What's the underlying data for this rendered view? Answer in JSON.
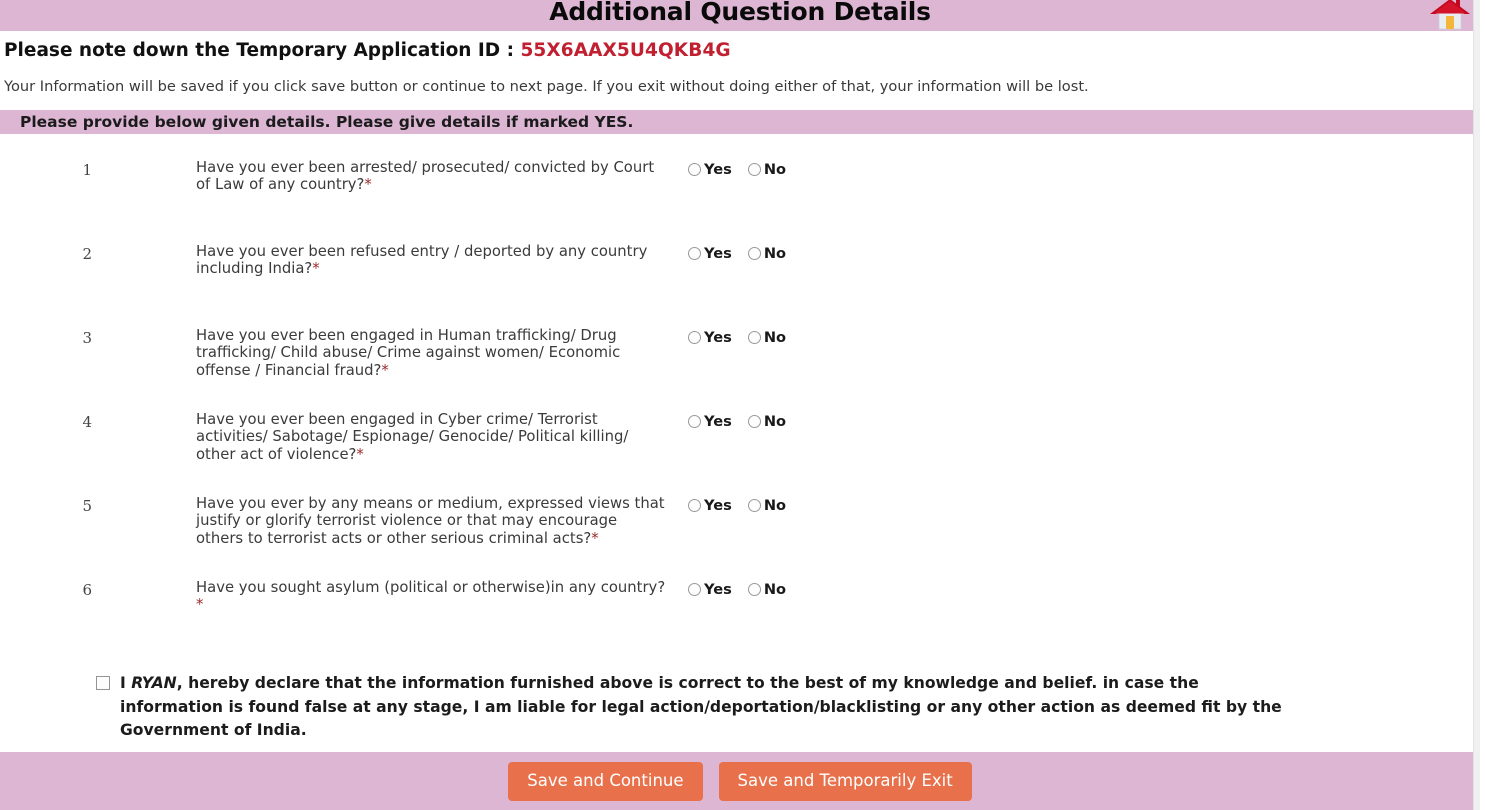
{
  "header": {
    "title": "Additional Question Details",
    "home_icon": "home-icon"
  },
  "app_id": {
    "label": "Please note down the Temporary Application ID : ",
    "value": "55X6AAX5U4QKB4G"
  },
  "notice": "Your Information will be saved if you click save button or continue to next page. If you exit without doing either of that, your information will be lost.",
  "section_header": "Please provide below given details. Please give details if marked YES.",
  "questions": [
    {
      "number": "1",
      "text": "Have you ever been arrested/ prosecuted/ convicted by Court of Law of any country?",
      "required_mark": "*",
      "options": [
        {
          "label": "Yes",
          "selected": false
        },
        {
          "label": "No",
          "selected": false
        }
      ]
    },
    {
      "number": "2",
      "text": "Have you ever been refused entry / deported by any country including India?",
      "required_mark": "*",
      "options": [
        {
          "label": "Yes",
          "selected": false
        },
        {
          "label": "No",
          "selected": false
        }
      ]
    },
    {
      "number": "3",
      "text": "Have you ever been engaged in Human trafficking/ Drug trafficking/ Child abuse/ Crime against women/ Economic offense / Financial fraud?",
      "required_mark": "*",
      "options": [
        {
          "label": "Yes",
          "selected": false
        },
        {
          "label": "No",
          "selected": false
        }
      ]
    },
    {
      "number": "4",
      "text": "Have you ever been engaged in Cyber crime/ Terrorist activities/ Sabotage/ Espionage/ Genocide/ Political killing/ other act of violence?",
      "required_mark": "*",
      "options": [
        {
          "label": "Yes",
          "selected": false
        },
        {
          "label": "No",
          "selected": false
        }
      ]
    },
    {
      "number": "5",
      "text": "Have you ever by any means or medium, expressed views that justify or glorify terrorist violence or that may encourage others to terrorist acts or other serious criminal acts?",
      "required_mark": "*",
      "options": [
        {
          "label": "Yes",
          "selected": false
        },
        {
          "label": "No",
          "selected": false
        }
      ]
    },
    {
      "number": "6",
      "text": "Have you sought asylum (political or otherwise)in any country?",
      "required_mark": "*",
      "options": [
        {
          "label": "Yes",
          "selected": false
        },
        {
          "label": "No",
          "selected": false
        }
      ]
    }
  ],
  "declaration": {
    "checked": false,
    "prefix": "I ",
    "name": "RYAN",
    "body": ", hereby declare that the information furnished above is correct to the best of my knowledge and belief. in case the information is found false at any stage, I am liable for legal action/deportation/blacklisting or any other action as deemed fit by the Government of India."
  },
  "footer": {
    "save_continue_label": "Save and Continue",
    "save_exit_label": "Save and Temporarily Exit",
    "button_color": "#e8714c",
    "band_color": "#ddb6d4"
  }
}
